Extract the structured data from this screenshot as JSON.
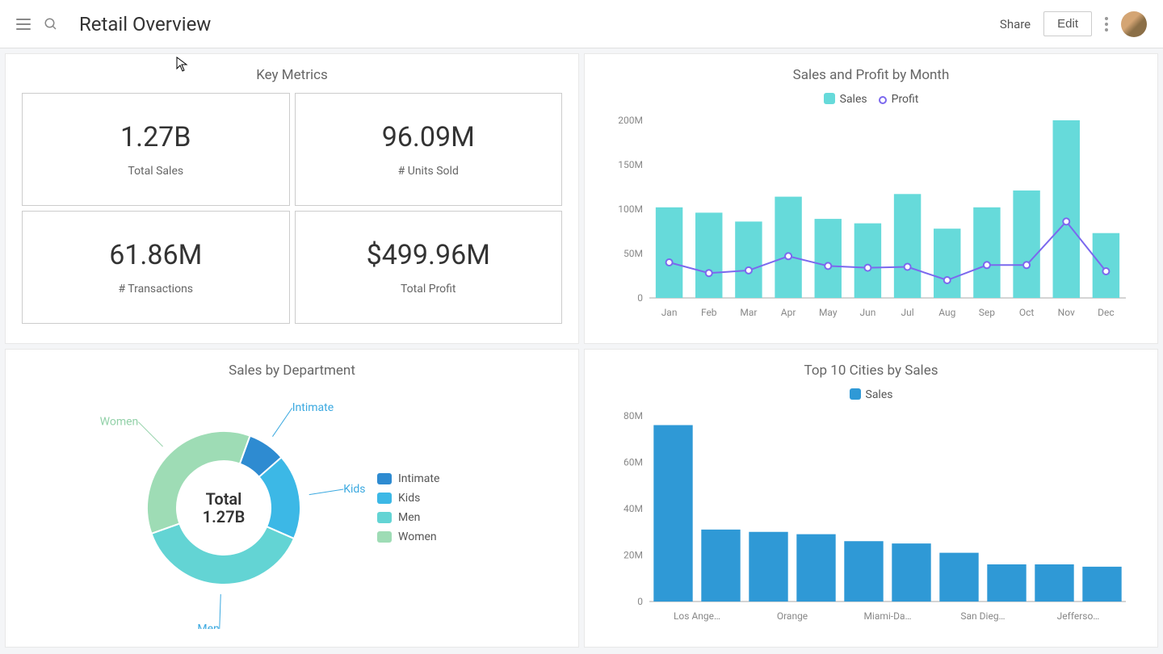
{
  "header": {
    "title": "Retail Overview",
    "share": "Share",
    "edit": "Edit"
  },
  "panels": {
    "metrics": {
      "title": "Key Metrics",
      "cards": [
        {
          "value": "1.27B",
          "label": "Total Sales"
        },
        {
          "value": "96.09M",
          "label": "# Units Sold"
        },
        {
          "value": "61.86M",
          "label": "# Transactions"
        },
        {
          "value": "$499.96M",
          "label": "Total Profit"
        }
      ]
    },
    "month": {
      "title": "Sales and Profit by Month",
      "legend_sales": "Sales",
      "legend_profit": "Profit"
    },
    "dept": {
      "title": "Sales by Department",
      "center_label": "Total",
      "center_value": "1.27B",
      "items": [
        {
          "name": "Intimate",
          "color": "#2e8bd1"
        },
        {
          "name": "Kids",
          "color": "#3cb8e6"
        },
        {
          "name": "Men",
          "color": "#63d4d4"
        },
        {
          "name": "Women",
          "color": "#9edcb5"
        }
      ]
    },
    "cities": {
      "title": "Top 10 Cities by Sales",
      "legend_sales": "Sales"
    }
  },
  "chart_data": [
    {
      "id": "sales_profit_by_month",
      "type": "bar+line",
      "categories": [
        "Jan",
        "Feb",
        "Mar",
        "Apr",
        "May",
        "Jun",
        "Jul",
        "Aug",
        "Sep",
        "Oct",
        "Nov",
        "Dec"
      ],
      "series": [
        {
          "name": "Sales",
          "type": "bar",
          "color": "#66dada",
          "values": [
            102,
            96,
            86,
            114,
            89,
            84,
            117,
            78,
            102,
            121,
            200,
            73
          ]
        },
        {
          "name": "Profit",
          "type": "line",
          "color": "#7b68ee",
          "values": [
            40,
            28,
            31,
            47,
            36,
            34,
            35,
            20,
            37,
            37,
            86,
            30
          ]
        }
      ],
      "ylabel": "",
      "ylim": [
        0,
        200
      ],
      "y_ticks": [
        0,
        "50M",
        "100M",
        "150M",
        "200M"
      ]
    },
    {
      "id": "sales_by_department",
      "type": "donut",
      "title": "Sales by Department",
      "total_label": "Total",
      "total_value": "1.27B",
      "slices": [
        {
          "name": "Intimate",
          "value_pct": 8,
          "color": "#2e8bd1"
        },
        {
          "name": "Kids",
          "value_pct": 18,
          "color": "#3cb8e6"
        },
        {
          "name": "Men",
          "value_pct": 38,
          "color": "#63d4d4"
        },
        {
          "name": "Women",
          "value_pct": 36,
          "color": "#9edcb5"
        }
      ]
    },
    {
      "id": "top_cities",
      "type": "bar",
      "title": "Top 10 Cities by Sales",
      "categories": [
        "Los Ange…",
        "",
        "Orange",
        "",
        "Miami-Da…",
        "",
        "San Dieg…",
        "",
        "Jefferso…",
        ""
      ],
      "series": [
        {
          "name": "Sales",
          "color": "#2f99d6",
          "values": [
            76,
            31,
            30,
            29,
            26,
            25,
            21,
            16,
            16,
            15
          ]
        }
      ],
      "ylabel": "",
      "ylim": [
        0,
        80
      ],
      "y_ticks": [
        0,
        "20M",
        "40M",
        "60M",
        "80M"
      ]
    }
  ]
}
